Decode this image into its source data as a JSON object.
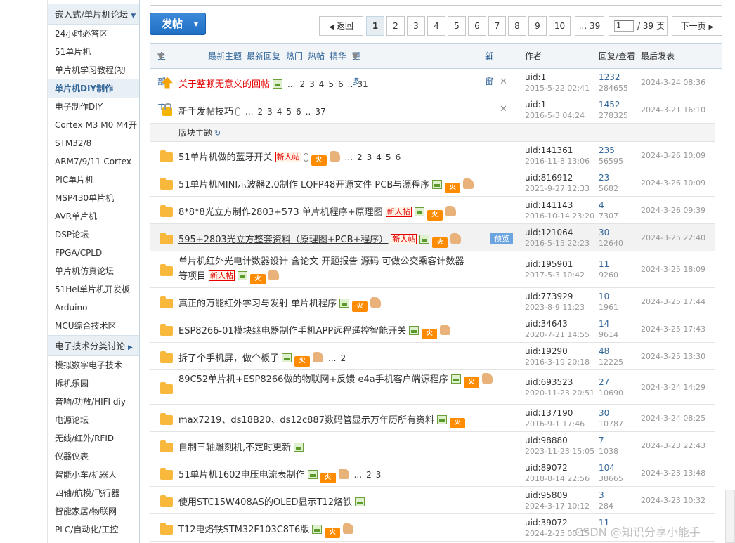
{
  "sidebar": {
    "groups": [
      {
        "title": "嵌入式/单片机论坛",
        "items": [
          "24小时必答区",
          "51单片机",
          "单片机学习教程(初",
          "单片机DIY制作",
          "电子制作DIY",
          "Cortex M3 M0 M4开",
          "STM32/8",
          "ARM7/9/11 Cortex-",
          "PIC单片机",
          "MSP430单片机",
          "AVR单片机",
          "DSP论坛",
          "FPGA/CPLD",
          "单片机仿真论坛",
          "51Hei单片机开发板",
          "Arduino",
          "MCU综合技术区"
        ]
      },
      {
        "title": "电子技术分类讨论",
        "items": [
          "模拟数字电子技术",
          "拆机乐园",
          "音响/功放/HIFI diy",
          "电源论坛",
          "无线/红外/RFID",
          "仪器仪表",
          "智能小车/机器人",
          "四轴/航模/飞行器",
          "智能家居/物联网",
          "PLC/自动化/工控"
        ]
      }
    ],
    "active_item": "单片机DIY制作"
  },
  "toolbar": {
    "post_label": "发帖",
    "back_label": "返回",
    "pages": [
      "1",
      "2",
      "3",
      "4",
      "5",
      "6",
      "7",
      "8",
      "9",
      "10",
      "... 39"
    ],
    "current_page": "1",
    "jump_value": "1",
    "total_pages": "/ 39 页",
    "next_label": "下一页"
  },
  "table_header": {
    "filters": [
      "全部主题",
      "最新主题",
      "最新回复",
      "热门",
      "热帖",
      "精华",
      "更多"
    ],
    "new_window": "新窗",
    "author": "作者",
    "replies_views": "回复/查看",
    "last_post": "最后发表"
  },
  "badges": {
    "new": "新人帖",
    "hot": "火",
    "preview": "预览"
  },
  "section_label": "版块主题",
  "threads": [
    {
      "title": "关于整顿无意义的回帖",
      "pages": [
        "...",
        "2",
        "3",
        "4",
        "5",
        "6",
        "..",
        "31"
      ],
      "author": "uid:1",
      "date": "2015-5-22 02:41",
      "replies": "1232",
      "views": "284655",
      "last": "2024-3-24 08:36"
    },
    {
      "title": "新手发帖技巧",
      "pages": [
        "...",
        "2",
        "3",
        "4",
        "5",
        "6",
        "..",
        "37"
      ],
      "author": "uid:1",
      "date": "2016-5-3 04:24",
      "replies": "1452",
      "views": "278325",
      "last": "2024-3-21 16:10"
    },
    {
      "title": "51单片机做的蓝牙开关",
      "pages": [
        "...",
        "2",
        "3",
        "4",
        "5",
        "6"
      ],
      "author": "uid:141361",
      "date": "2016-11-8 13:06",
      "replies": "235",
      "views": "56595",
      "last": "2024-3-26 10:09"
    },
    {
      "title": "51单片机MINI示波器2.0制作 LQFP48开源文件 PCB与源程序",
      "author": "uid:816912",
      "date": "2021-9-27 12:33",
      "replies": "23",
      "views": "5682",
      "last": "2024-3-26 10:09"
    },
    {
      "title": "8*8*8光立方制作2803+573 单片机程序+原理图",
      "author": "uid:141143",
      "date": "2016-10-14 23:20",
      "replies": "4",
      "views": "7307",
      "last": "2024-3-26 09:39"
    },
    {
      "title": "595+2803光立方整套资料（原理图+PCB+程序）",
      "author": "uid:121064",
      "date": "2016-5-15 22:23",
      "replies": "30",
      "views": "12640",
      "last": "2024-3-25 22:40"
    },
    {
      "title_line1": "单片机红外光电计数器设计 含论文 开题报告 源码 可做公交乘客计数器",
      "title_line2": "等项目",
      "author": "uid:195901",
      "date": "2017-5-3 10:42",
      "replies": "11",
      "views": "9260",
      "last": "2024-3-25 18:09"
    },
    {
      "title": "真正的万能红外学习与发射 单片机程序",
      "author": "uid:773929",
      "date": "2023-8-9 11:23",
      "replies": "10",
      "views": "1961",
      "last": "2024-3-25 17:44"
    },
    {
      "title": "ESP8266-01模块继电器制作手机APP远程遥控智能开关",
      "author": "uid:34643",
      "date": "2020-7-21 14:55",
      "replies": "14",
      "views": "9614",
      "last": "2024-3-25 17:43"
    },
    {
      "title": "拆了个手机屏，做个板子",
      "pages": [
        "...",
        "2"
      ],
      "author": "uid:19290",
      "date": "2016-3-19 20:18",
      "replies": "48",
      "views": "12225",
      "last": "2024-3-25 13:30"
    },
    {
      "title": "89C52单片机+ESP8266做的物联网+反馈 e4a手机客户端源程序",
      "author": "uid:693523",
      "date": "2020-11-23 20:51",
      "replies": "27",
      "views": "10690",
      "last": "2024-3-24 14:29"
    },
    {
      "title": "max7219、ds18B20、ds12c887数码管显示万年历所有资料",
      "author": "uid:137190",
      "date": "2016-9-1 17:46",
      "replies": "30",
      "views": "10787",
      "last": "2024-3-24 08:25"
    },
    {
      "title": "自制三轴雕刻机,不定时更新",
      "author": "uid:98880",
      "date": "2023-11-23 15:05",
      "replies": "7",
      "views": "1038",
      "last": "2024-3-23 22:43"
    },
    {
      "title": "51单片机1602电压电流表制作",
      "pages": [
        "...",
        "2",
        "3"
      ],
      "author": "uid:89072",
      "date": "2018-8-14 22:56",
      "replies": "104",
      "views": "38665",
      "last": "2024-3-23 13:48"
    },
    {
      "title": "使用STC15W408AS的OLED显示T12烙铁",
      "author": "uid:95809",
      "date": "2024-3-17 10:12",
      "replies": "3",
      "views": "284",
      "last": "2024-3-23 10:32"
    },
    {
      "title": "T12电烙铁STM32F103C8T6版",
      "author": "uid:39072",
      "date": "2024-2-25 00:15",
      "replies": "11",
      "views": "",
      "last": ""
    }
  ],
  "watermark": "CSDN @知识分享小能手"
}
